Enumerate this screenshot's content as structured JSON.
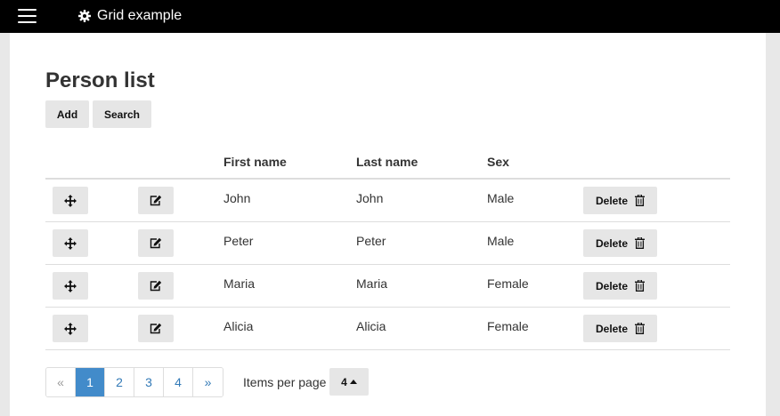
{
  "app": {
    "title": "Grid example"
  },
  "page": {
    "title": "Person list"
  },
  "toolbar": {
    "add_label": "Add",
    "search_label": "Search"
  },
  "table": {
    "columns": [
      "First name",
      "Last name",
      "Sex"
    ],
    "delete_label": "Delete",
    "rows": [
      {
        "first": "John",
        "last": "John",
        "sex": "Male"
      },
      {
        "first": "Peter",
        "last": "Peter",
        "sex": "Male"
      },
      {
        "first": "Maria",
        "last": "Maria",
        "sex": "Female"
      },
      {
        "first": "Alicia",
        "last": "Alicia",
        "sex": "Female"
      }
    ]
  },
  "pagination": {
    "prev": "«",
    "pages": [
      "1",
      "2",
      "3",
      "4"
    ],
    "active_page": "1",
    "next": "»"
  },
  "items_per_page": {
    "label": "Items per page",
    "value": "4"
  },
  "icons": {
    "menu": "hamburger-icon",
    "title": "gear-icon",
    "move": "move-arrows-icon",
    "edit": "edit-icon",
    "delete": "trash-icon",
    "caret": "caret-up-icon"
  },
  "colors": {
    "topbar": "#000000",
    "active_page": "#428bca",
    "link": "#337ab7"
  }
}
